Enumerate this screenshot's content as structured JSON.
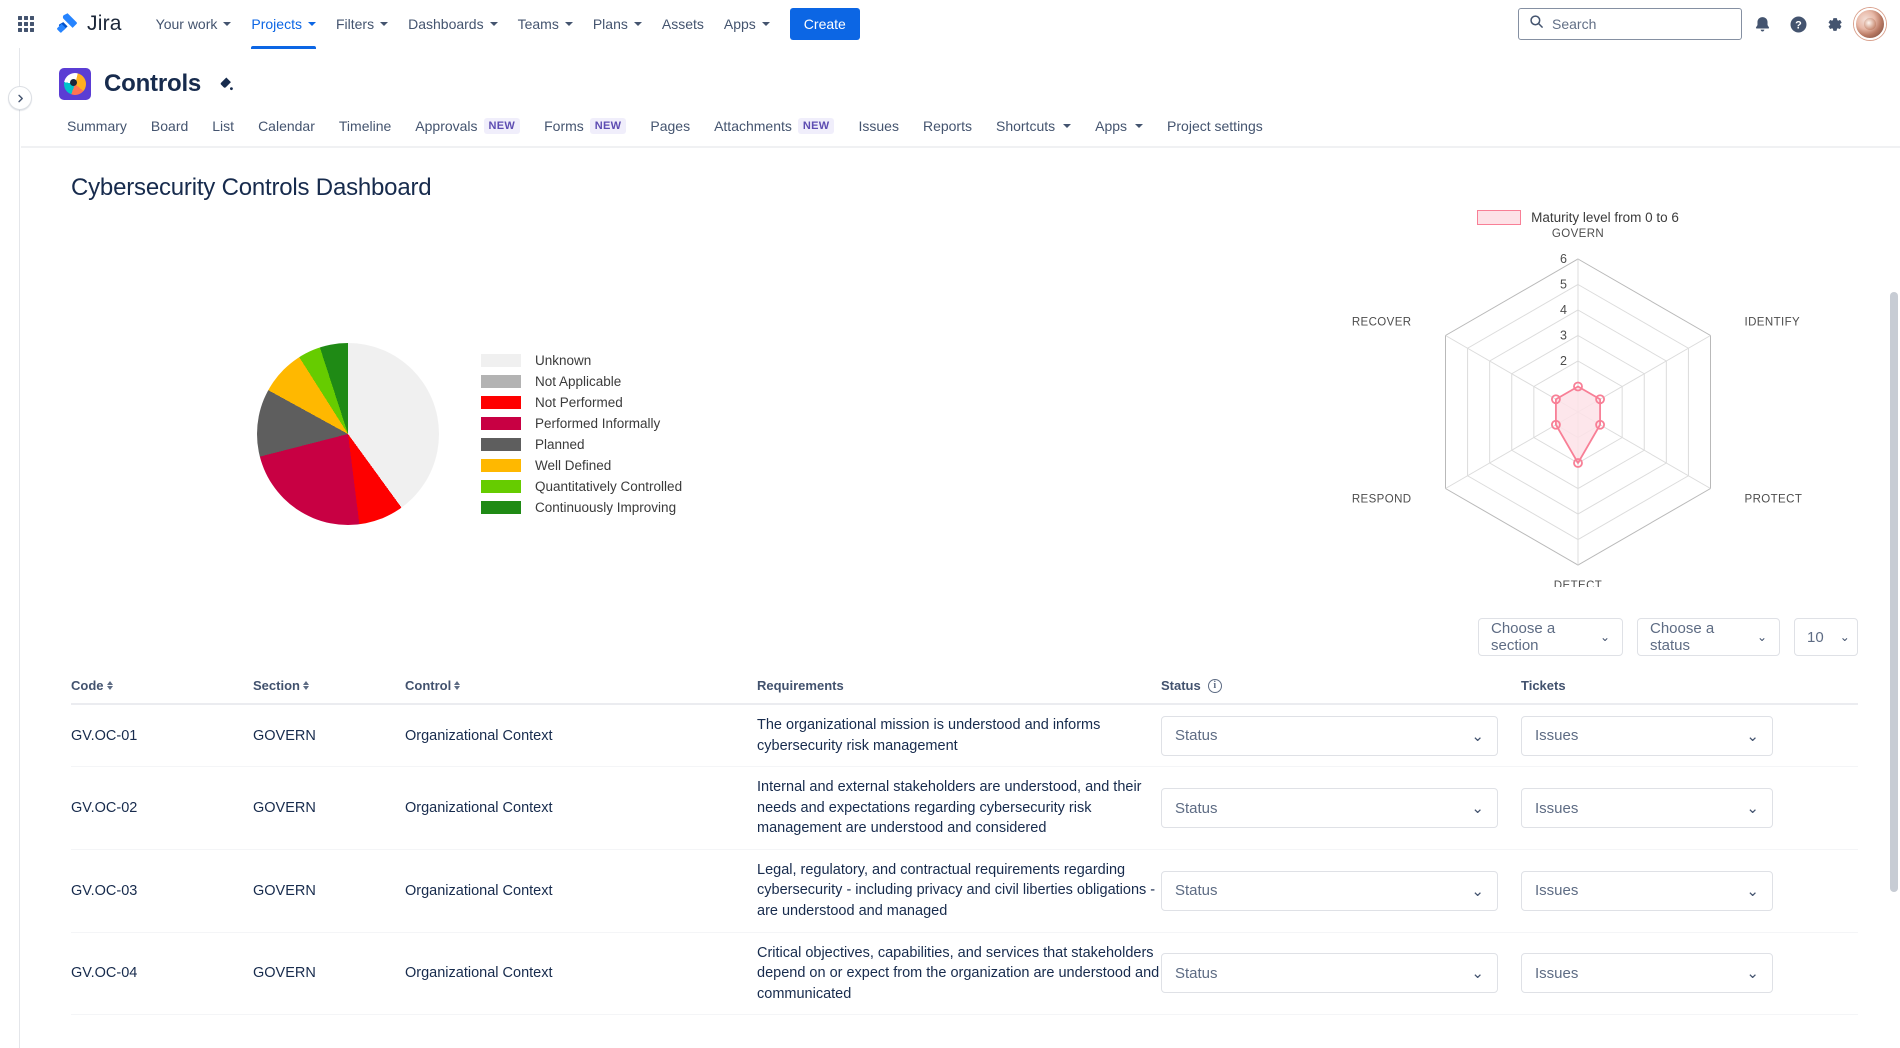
{
  "topnav": {
    "app_switcher": "app-switcher",
    "product_name": "Jira",
    "items": [
      {
        "label": "Your work",
        "has_caret": true,
        "active": false
      },
      {
        "label": "Projects",
        "has_caret": true,
        "active": true
      },
      {
        "label": "Filters",
        "has_caret": true,
        "active": false
      },
      {
        "label": "Dashboards",
        "has_caret": true,
        "active": false
      },
      {
        "label": "Teams",
        "has_caret": true,
        "active": false
      },
      {
        "label": "Plans",
        "has_caret": true,
        "active": false
      },
      {
        "label": "Assets",
        "has_caret": false,
        "active": false
      },
      {
        "label": "Apps",
        "has_caret": true,
        "active": false
      }
    ],
    "create_label": "Create",
    "search_placeholder": "Search",
    "icons": [
      "notifications-icon",
      "help-icon",
      "settings-icon",
      "avatar"
    ]
  },
  "project": {
    "name": "Controls",
    "icon": "project-avatar-icon",
    "edit_icon": "paint-brush-icon",
    "expand_icon": "expand-sidebar-icon"
  },
  "tabs": [
    {
      "label": "Summary",
      "badge": ""
    },
    {
      "label": "Board",
      "badge": ""
    },
    {
      "label": "List",
      "badge": ""
    },
    {
      "label": "Calendar",
      "badge": ""
    },
    {
      "label": "Timeline",
      "badge": ""
    },
    {
      "label": "Approvals",
      "badge": "NEW"
    },
    {
      "label": "Forms",
      "badge": "NEW"
    },
    {
      "label": "Pages",
      "badge": ""
    },
    {
      "label": "Attachments",
      "badge": "NEW"
    },
    {
      "label": "Issues",
      "badge": ""
    },
    {
      "label": "Reports",
      "badge": ""
    },
    {
      "label": "Shortcuts",
      "badge": "",
      "caret": true
    },
    {
      "label": "Apps",
      "badge": "",
      "caret": true
    },
    {
      "label": "Project settings",
      "badge": ""
    }
  ],
  "page": {
    "title": "Cybersecurity Controls Dashboard"
  },
  "chart_data": [
    {
      "type": "pie",
      "title": "",
      "legend_position": "right",
      "categories": [
        "Unknown",
        "Not Applicable",
        "Not Performed",
        "Performed Informally",
        "Planned",
        "Well Defined",
        "Quantitatively Controlled",
        "Continuously Improving"
      ],
      "colors": [
        "#f0f0f0",
        "#b3b3b3",
        "#fe0000",
        "#c80043",
        "#5e5e5e",
        "#ffb800",
        "#66cc00",
        "#1f8a15"
      ],
      "values": [
        40,
        0,
        8,
        23,
        12,
        8,
        4,
        5
      ]
    },
    {
      "type": "radar",
      "title": "",
      "legend": "Maturity level from 0 to 6",
      "categories": [
        "GOVERN",
        "IDENTIFY",
        "PROTECT",
        "DETECT",
        "RESPOND",
        "RECOVER"
      ],
      "values": [
        1,
        1,
        1,
        2,
        1,
        1
      ],
      "rlim": [
        0,
        6
      ],
      "tick_labels": [
        "2",
        "3",
        "4",
        "5",
        "6"
      ],
      "fill_color": "#fde2e7",
      "line_color": "#f87f96",
      "grid": true
    }
  ],
  "filters": {
    "section": "Choose a section",
    "status": "Choose a status",
    "page_size": "10"
  },
  "table": {
    "headers": {
      "code": "Code",
      "section": "Section",
      "control": "Control",
      "requirements": "Requirements",
      "status": "Status",
      "tickets": "Tickets"
    },
    "rows": [
      {
        "code": "GV.OC-01",
        "section": "GOVERN",
        "control": "Organizational Context",
        "requirements": "The organizational mission is understood and informs cybersecurity risk management",
        "status": "Status",
        "tickets": "Issues"
      },
      {
        "code": "GV.OC-02",
        "section": "GOVERN",
        "control": "Organizational Context",
        "requirements": "Internal and external stakeholders are understood, and their needs and expectations regarding cybersecurity risk management are understood and considered",
        "status": "Status",
        "tickets": "Issues"
      },
      {
        "code": "GV.OC-03",
        "section": "GOVERN",
        "control": "Organizational Context",
        "requirements": "Legal, regulatory, and contractual requirements regarding cybersecurity - including privacy and civil liberties obligations - are understood and managed",
        "status": "Status",
        "tickets": "Issues"
      },
      {
        "code": "GV.OC-04",
        "section": "GOVERN",
        "control": "Organizational Context",
        "requirements": "Critical objectives, capabilities, and services that stakeholders depend on or expect from the organization are understood and communicated",
        "status": "Status",
        "tickets": "Issues"
      }
    ]
  },
  "colors": {
    "brand_blue": "#0c66e4",
    "text": "#172b4d",
    "muted": "#44546f"
  }
}
